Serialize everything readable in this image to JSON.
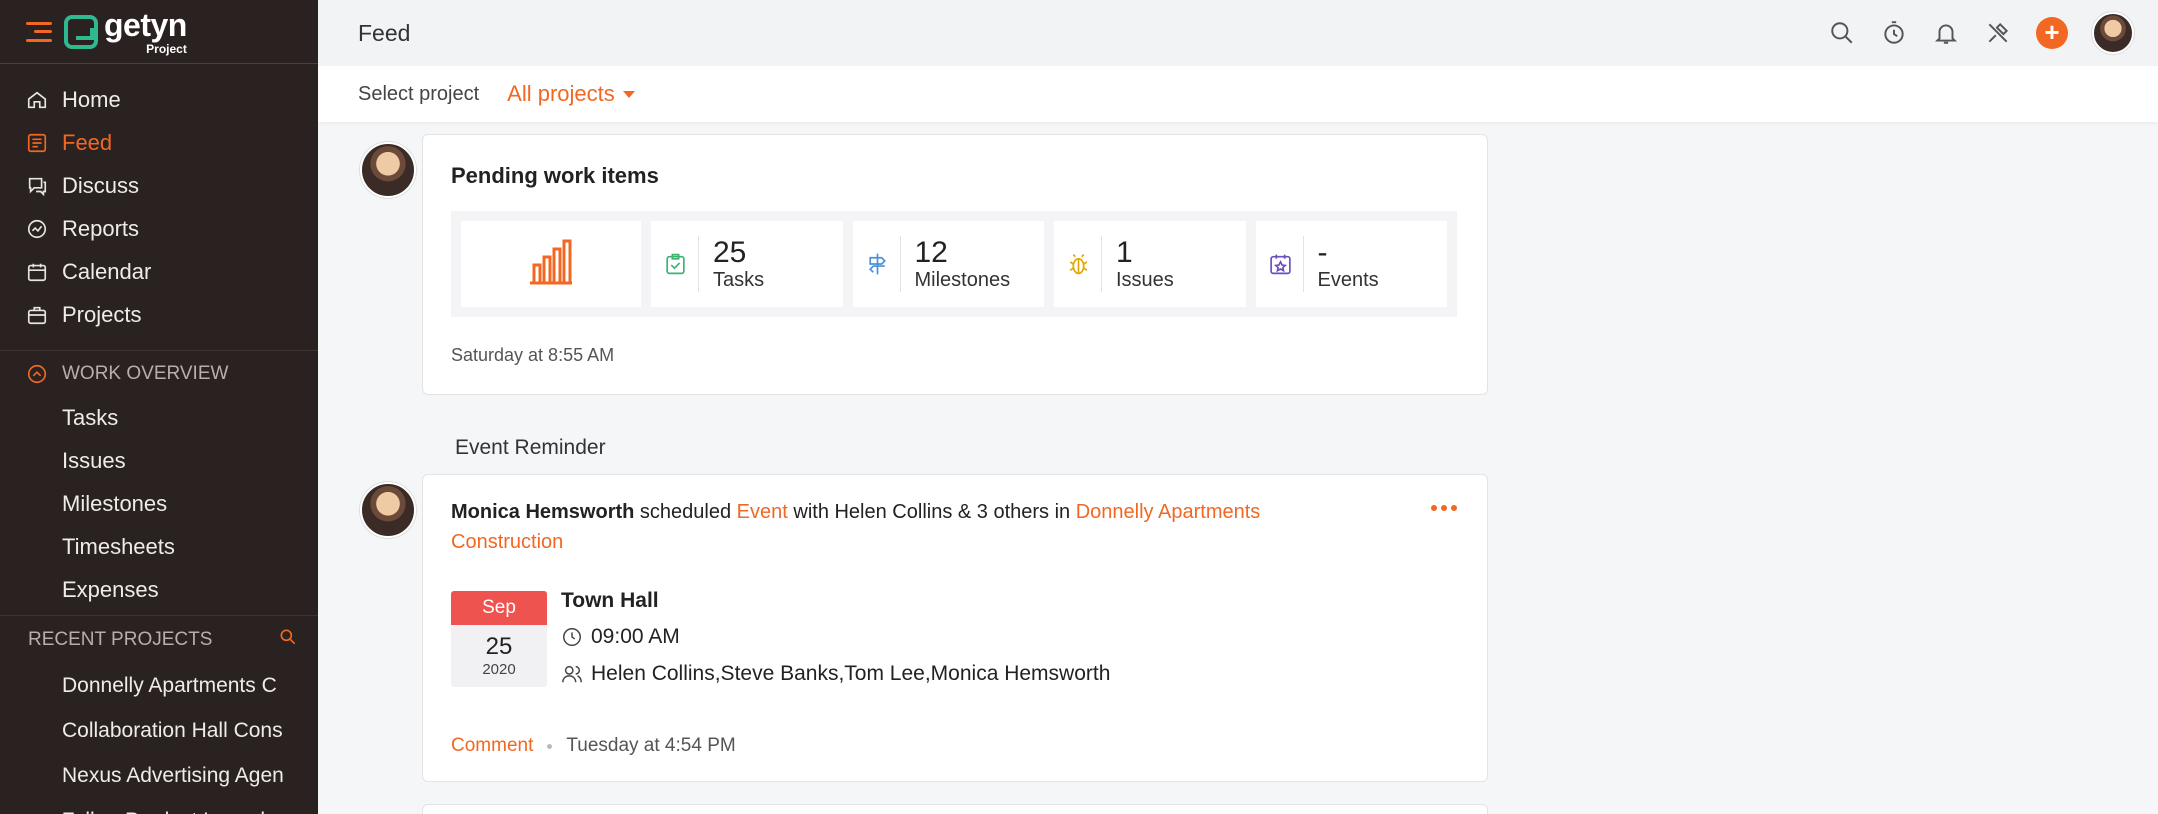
{
  "app": {
    "brand_name": "getyn",
    "brand_sub": "Project",
    "accent_color": "#f26722",
    "brand_color": "#2fb98e"
  },
  "sidebar": {
    "items": [
      {
        "label": "Home",
        "icon": "home-icon"
      },
      {
        "label": "Feed",
        "icon": "feed-icon",
        "active": true
      },
      {
        "label": "Discuss",
        "icon": "discuss-icon"
      },
      {
        "label": "Reports",
        "icon": "reports-icon"
      },
      {
        "label": "Calendar",
        "icon": "calendar-icon"
      },
      {
        "label": "Projects",
        "icon": "projects-icon"
      }
    ],
    "work_overview": {
      "title": "WORK OVERVIEW",
      "items": [
        "Tasks",
        "Issues",
        "Milestones",
        "Timesheets",
        "Expenses"
      ]
    },
    "recent_projects": {
      "title": "RECENT PROJECTS",
      "items": [
        "Donnelly Apartments C",
        "Collaboration Hall Cons",
        "Nexus Advertising Agen",
        "Zylker Product Launch"
      ]
    }
  },
  "header": {
    "title": "Feed"
  },
  "project_bar": {
    "label": "Select project",
    "selected": "All projects"
  },
  "pending": {
    "title": "Pending work items",
    "stats": [
      {
        "value": "25",
        "label": "Tasks",
        "icon": "task-check-icon"
      },
      {
        "value": "12",
        "label": "Milestones",
        "icon": "milestone-signpost-icon"
      },
      {
        "value": "1",
        "label": "Issues",
        "icon": "bug-icon"
      },
      {
        "value": "-",
        "label": "Events",
        "icon": "event-calendar-icon"
      }
    ],
    "timestamp": "Saturday at 8:55 AM"
  },
  "event_section": {
    "heading": "Event Reminder"
  },
  "event_card": {
    "actor": "Monica Hemsworth",
    "verb": " scheduled ",
    "event_link": "Event",
    "middle": " with Helen Collins & 3 others in ",
    "project_link": "Donnelly Apartments Construction",
    "date": {
      "month": "Sep",
      "day": "25",
      "year": "2020"
    },
    "event_title": "Town Hall",
    "time": "09:00 AM",
    "attendees": "Helen Collins,Steve Banks,Tom Lee,Monica Hemsworth",
    "comment_label": "Comment",
    "timestamp": "Tuesday at 4:54 PM"
  }
}
